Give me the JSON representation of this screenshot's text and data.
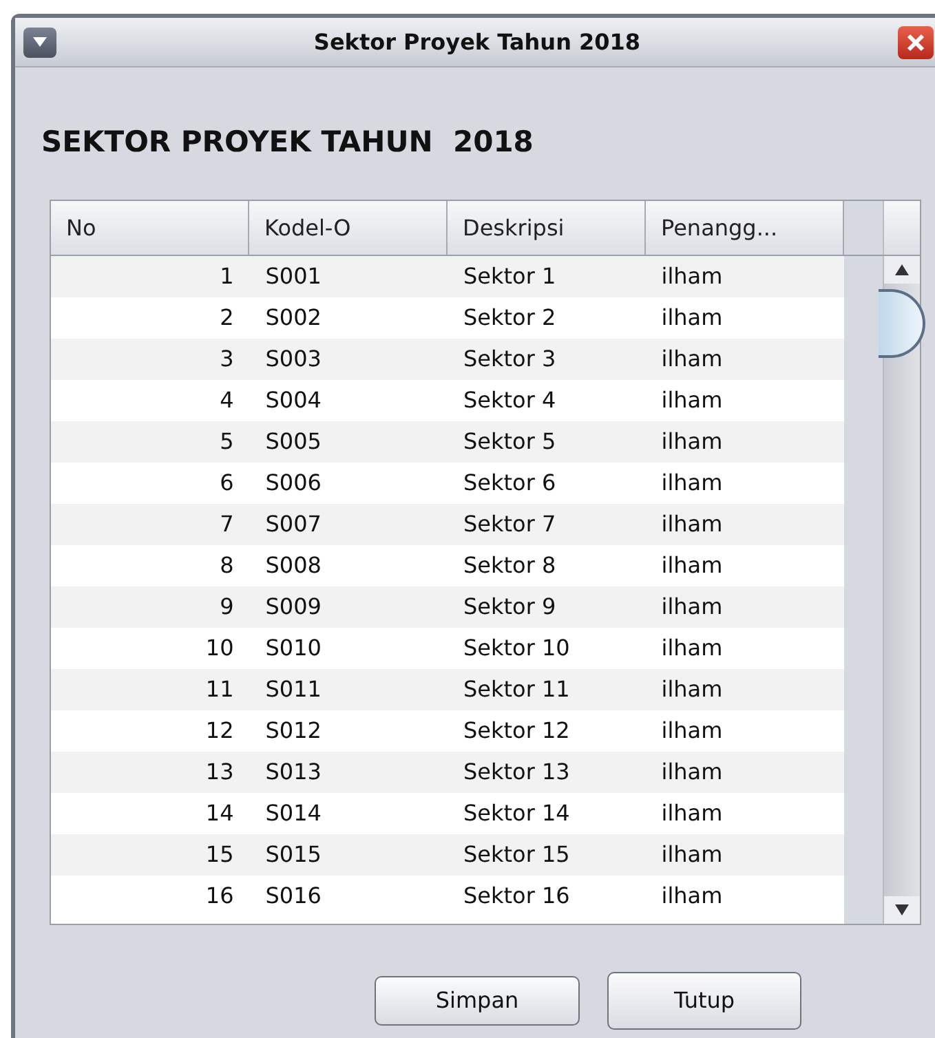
{
  "window": {
    "title": "Sektor Proyek Tahun 2018"
  },
  "heading": "SEKTOR PROYEK TAHUN  2018",
  "table": {
    "columns": [
      "No",
      "Kodel-O",
      "Deskripsi",
      "Penangg..."
    ],
    "rows": [
      [
        "1",
        "S001",
        "Sektor 1",
        "ilham"
      ],
      [
        "2",
        "S002",
        "Sektor 2",
        "ilham"
      ],
      [
        "3",
        "S003",
        "Sektor 3",
        "ilham"
      ],
      [
        "4",
        "S004",
        "Sektor 4",
        "ilham"
      ],
      [
        "5",
        "S005",
        "Sektor 5",
        "ilham"
      ],
      [
        "6",
        "S006",
        "Sektor 6",
        "ilham"
      ],
      [
        "7",
        "S007",
        "Sektor 7",
        "ilham"
      ],
      [
        "8",
        "S008",
        "Sektor 8",
        "ilham"
      ],
      [
        "9",
        "S009",
        "Sektor 9",
        "ilham"
      ],
      [
        "10",
        "S010",
        "Sektor 10",
        "ilham"
      ],
      [
        "11",
        "S011",
        "Sektor 11",
        "ilham"
      ],
      [
        "12",
        "S012",
        "Sektor 12",
        "ilham"
      ],
      [
        "13",
        "S013",
        "Sektor 13",
        "ilham"
      ],
      [
        "14",
        "S014",
        "Sektor 14",
        "ilham"
      ],
      [
        "15",
        "S015",
        "Sektor 15",
        "ilham"
      ],
      [
        "16",
        "S016",
        "Sektor 16",
        "ilham"
      ]
    ]
  },
  "buttons": [
    "Simpan",
    "Tutup"
  ]
}
